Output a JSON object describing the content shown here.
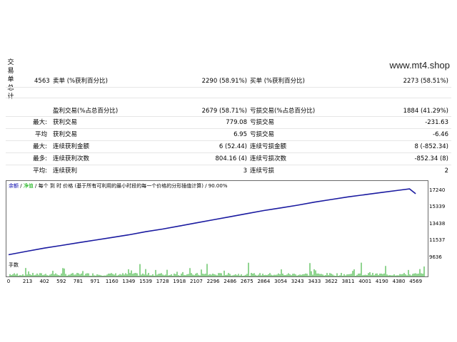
{
  "watermark": "www.mt4.shop",
  "side_label": [
    "交",
    "易",
    "单",
    "总",
    "计"
  ],
  "stats": {
    "total_trades": "4563",
    "short_label": "卖单 (%获利百分比)",
    "short_value": "2290 (58.91%)",
    "long_label": "买单 (%获利百分比)",
    "long_value": "2273 (58.51%)",
    "profit_trades_label": "盈利交易(%占总百分比)",
    "profit_trades_value": "2679 (58.71%)",
    "loss_trades_label": "亏损交易(%占总百分比)",
    "loss_trades_value": "1884 (41.29%)",
    "rows": [
      {
        "prefix": "最大:",
        "l_label": "获利交易",
        "l_value": "779.08",
        "r_label": "亏损交易",
        "r_value": "-231.63"
      },
      {
        "prefix": "平均",
        "l_label": "获利交易",
        "l_value": "6.95",
        "r_label": "亏损交易",
        "r_value": "-6.46"
      },
      {
        "prefix": "最大:",
        "l_label": "连续获利金额",
        "l_value": "6 (52.44)",
        "r_label": "连续亏损金额",
        "r_value": "8 (-852.34)"
      },
      {
        "prefix": "最多:",
        "l_label": "连续获利次数",
        "l_value": "804.16 (4)",
        "r_label": "连续亏损次数",
        "r_value": "-852.34 (8)"
      },
      {
        "prefix": "平均:",
        "l_label": "连续获利",
        "l_value": "3",
        "r_label": "连续亏损",
        "r_value": "2"
      }
    ]
  },
  "chart": {
    "title_part1": "余额",
    "title_sep": " / ",
    "title_part2": "净值",
    "title_rest": " / 每个 到 时 价格 (基于所有可利用的最小时段的每一个价格的分形插值计算) / 90.00%",
    "volume_label": "手数",
    "colors": {
      "balance": "#1a1aa0",
      "volume": "#22aa22"
    }
  },
  "chart_data": {
    "type": "line",
    "yticks": [
      9636,
      11537,
      13438,
      15339,
      17240
    ],
    "xticks": [
      0,
      213,
      402,
      592,
      781,
      971,
      1160,
      1349,
      1539,
      1728,
      1918,
      2107,
      2296,
      2486,
      2675,
      2864,
      3054,
      3243,
      3433,
      3622,
      3811,
      4001,
      4190,
      4380,
      4569
    ],
    "ylim": [
      9636,
      17700
    ],
    "xlim": [
      0,
      4680
    ],
    "series": [
      {
        "x": [
          0,
          213,
          402,
          592,
          781,
          971,
          1160,
          1349,
          1539,
          1728,
          1918,
          2107,
          2296,
          2486,
          2675,
          2864,
          3054,
          3243,
          3433,
          3622,
          3811,
          4001,
          4190,
          4380,
          4500,
          4569
        ],
        "y": [
          10000,
          10400,
          10750,
          11050,
          11350,
          11650,
          11950,
          12250,
          12600,
          12900,
          13250,
          13600,
          13950,
          14300,
          14650,
          15000,
          15300,
          15600,
          15950,
          16250,
          16550,
          16800,
          17050,
          17300,
          17450,
          16900
        ]
      }
    ]
  }
}
